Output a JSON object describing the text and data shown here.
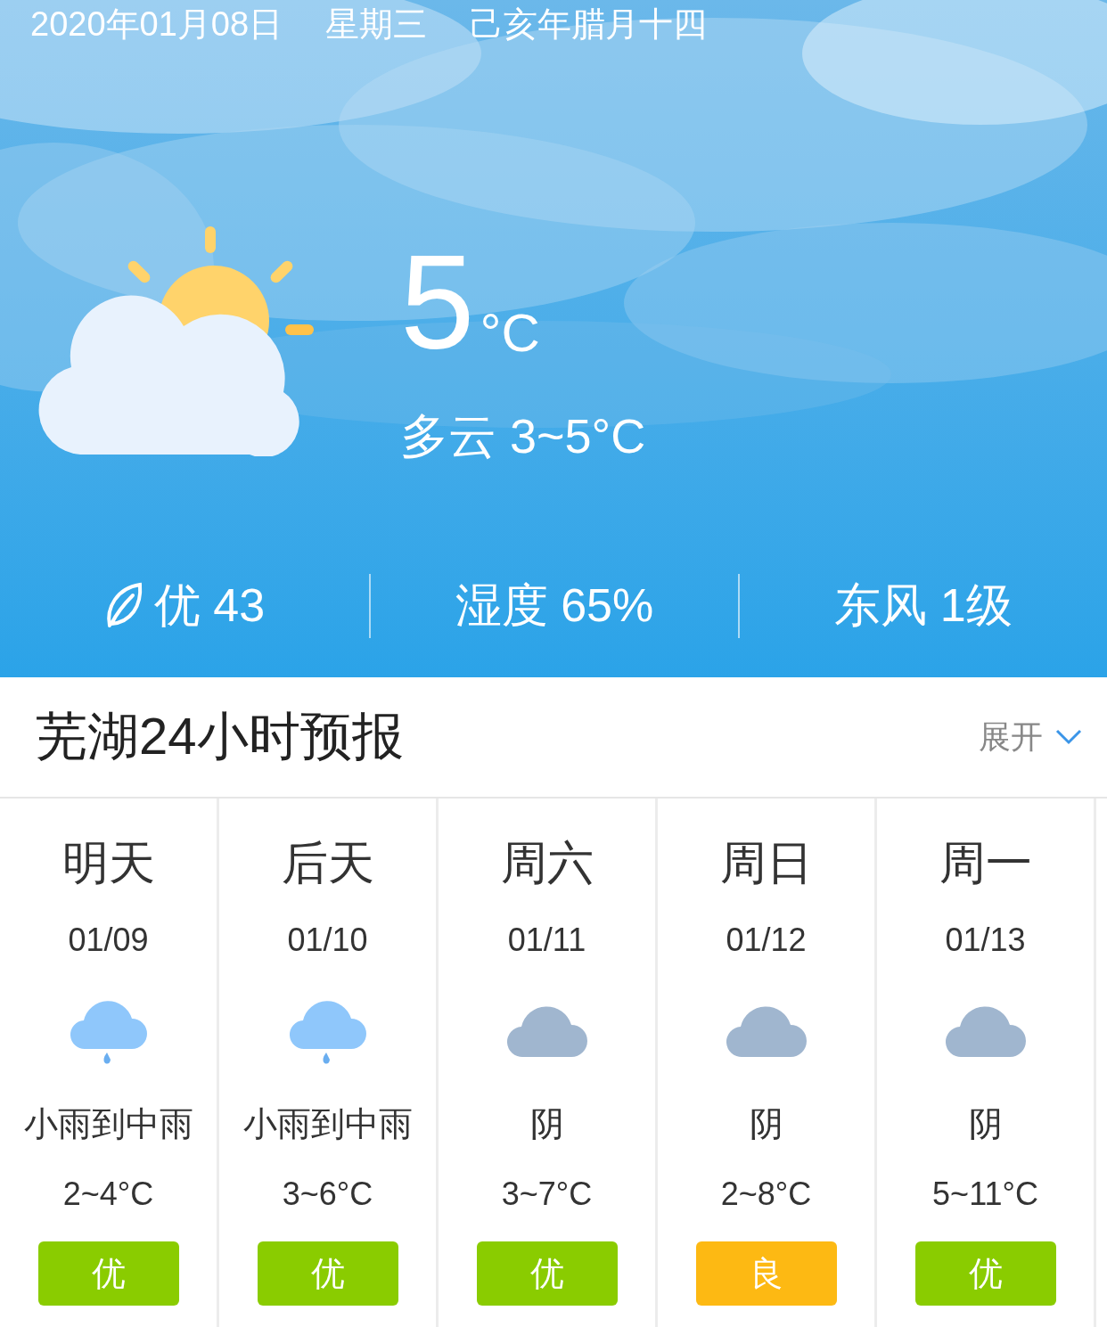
{
  "date_bar": {
    "date": "2020年01月08日",
    "weekday": "星期三",
    "lunar": "己亥年腊月十四"
  },
  "current": {
    "kind": "partly_cloudy",
    "temperature": "5",
    "unit": "°C",
    "summary": "多云 3~5°C"
  },
  "stats": [
    {
      "kind": "aqi",
      "text": "优 43"
    },
    {
      "kind": "plain",
      "text": "湿度 65%"
    },
    {
      "kind": "plain",
      "text": "东风 1级"
    }
  ],
  "forecast": {
    "title": "芜湖24小时预报",
    "toggle": "展开",
    "days": [
      {
        "day": "明天",
        "date": "01/09",
        "kind": "rain",
        "weather": "小雨到中雨",
        "temp": "2~4°C",
        "aqi": "优",
        "color": "#8acc00"
      },
      {
        "day": "后天",
        "date": "01/10",
        "kind": "rain",
        "weather": "小雨到中雨",
        "temp": "3~6°C",
        "aqi": "优",
        "color": "#8acc00"
      },
      {
        "day": "周六",
        "date": "01/11",
        "kind": "overcast",
        "weather": "阴",
        "temp": "3~7°C",
        "aqi": "优",
        "color": "#8acc00"
      },
      {
        "day": "周日",
        "date": "01/12",
        "kind": "overcast",
        "weather": "阴",
        "temp": "2~8°C",
        "aqi": "良",
        "color": "#fdb913"
      },
      {
        "day": "周一",
        "date": "01/13",
        "kind": "overcast",
        "weather": "阴",
        "temp": "5~11°C",
        "aqi": "优",
        "color": "#8acc00"
      }
    ]
  }
}
